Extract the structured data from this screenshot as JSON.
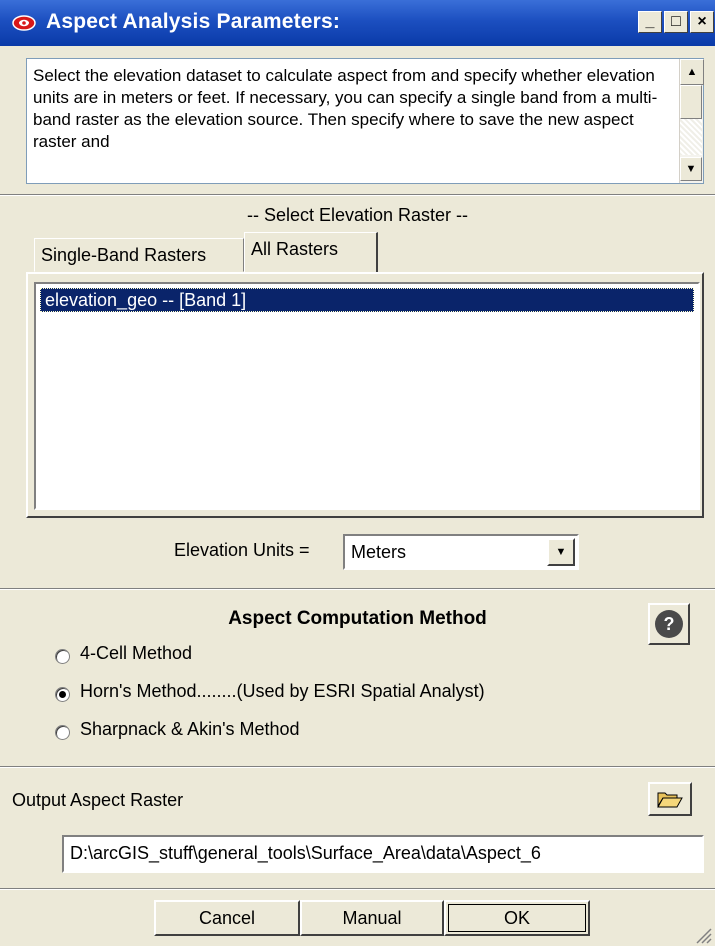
{
  "window": {
    "title": "Aspect Analysis Parameters:",
    "minimize": "_",
    "maximize": "□",
    "close": "×"
  },
  "description": "Select the elevation dataset to calculate aspect from and specify whether elevation units are in meters or feet. If necessary, you can specify a single band from a multi-band raster as the elevation source. Then specify where to save the new aspect raster and",
  "raster_section": {
    "heading": "-- Select Elevation Raster --",
    "tabs": [
      {
        "label": "Single-Band Rasters"
      },
      {
        "label": "All Rasters"
      }
    ],
    "items": [
      {
        "label": "elevation_geo -- [Band 1]"
      }
    ]
  },
  "units": {
    "label": "Elevation Units =",
    "value": "Meters"
  },
  "method": {
    "heading": "Aspect Computation Method",
    "help_icon": "?",
    "options": [
      {
        "label": "4-Cell Method"
      },
      {
        "label": "Horn's Method........(Used by ESRI Spatial Analyst)"
      },
      {
        "label": "Sharpnack & Akin's Method"
      }
    ],
    "selected": 1
  },
  "output": {
    "label": "Output Aspect Raster",
    "path": "D:\\arcGIS_stuff\\general_tools\\Surface_Area\\data\\Aspect_6"
  },
  "buttons": {
    "cancel": "Cancel",
    "manual": "Manual",
    "ok": "OK"
  },
  "colors": {
    "titlebar": "#1c4fc0",
    "selection": "#0a246a",
    "face": "#ece9d8"
  }
}
